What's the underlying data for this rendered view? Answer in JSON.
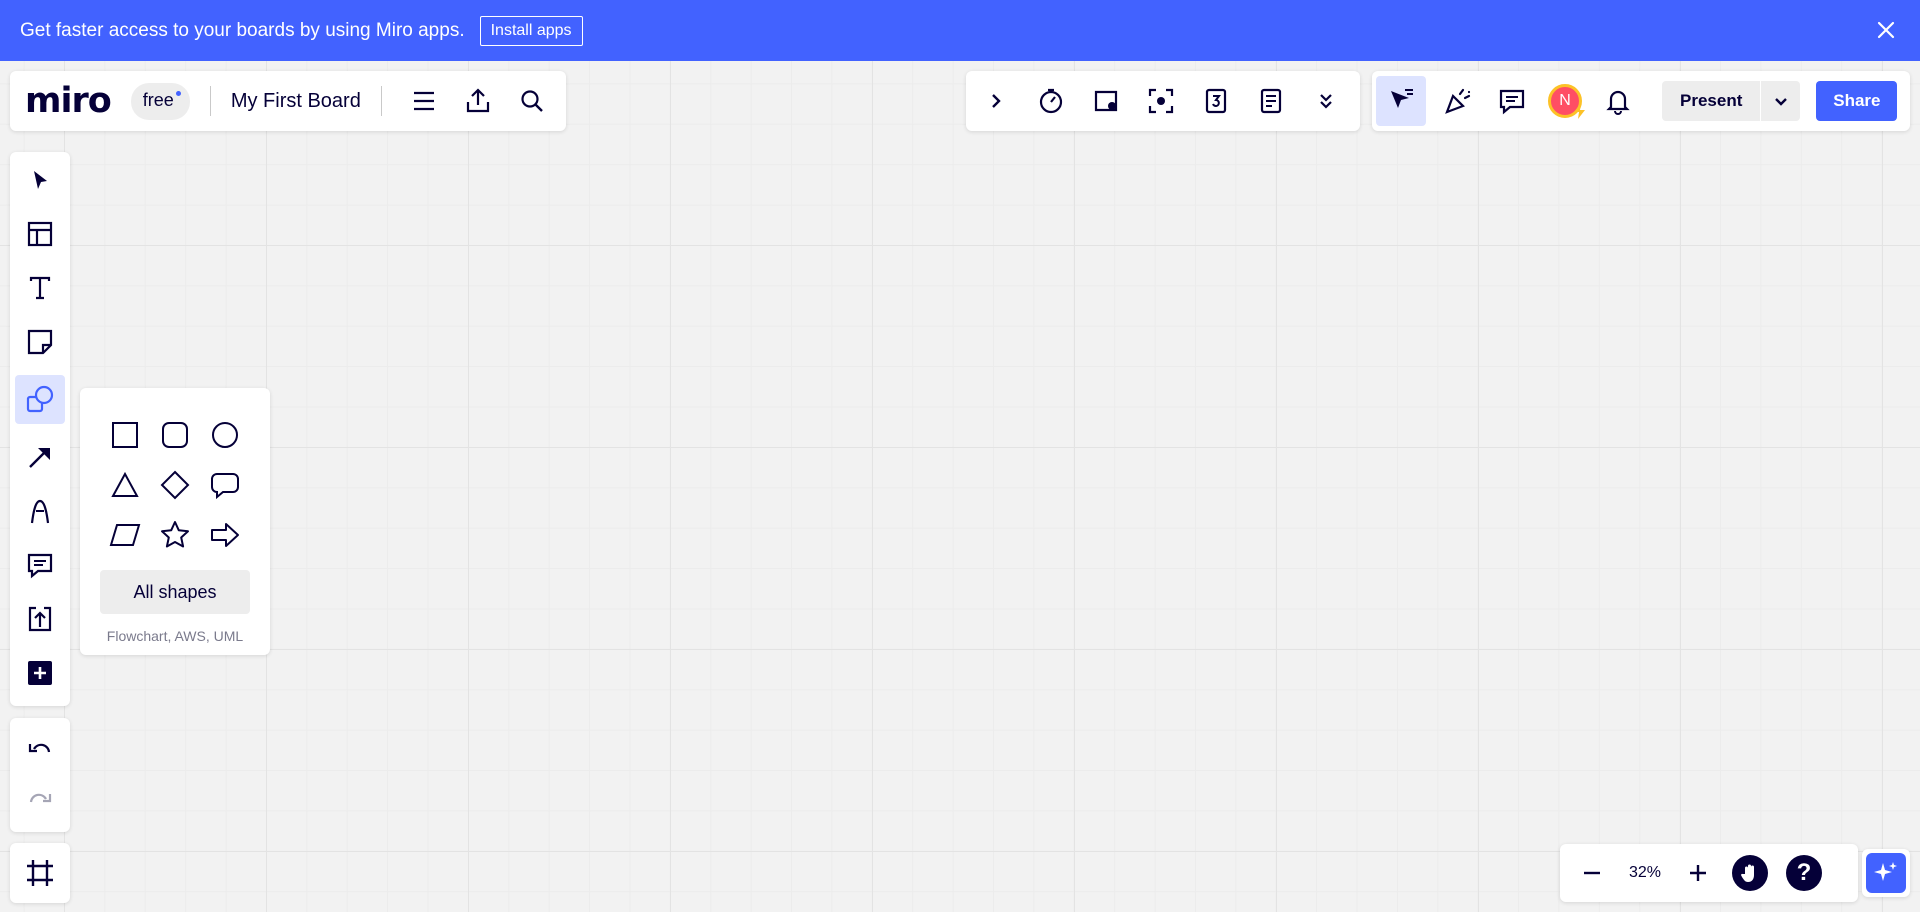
{
  "banner": {
    "message": "Get faster access to your boards by using Miro apps.",
    "install_label": "Install apps"
  },
  "board": {
    "logo": "miro",
    "plan": "free",
    "name": "My First Board"
  },
  "collab": {
    "avatar_initial": "N",
    "present_label": "Present",
    "share_label": "Share"
  },
  "shapes": {
    "all_shapes_label": "All shapes",
    "subtitle": "Flowchart, AWS, UML"
  },
  "zoom": {
    "level": "32%"
  },
  "help": {
    "label": "?"
  },
  "colors": {
    "accent": "#4262ff",
    "ink": "#050038",
    "avatar_bg": "#ff4e64",
    "avatar_ring": "#fcc227"
  },
  "icons": {
    "left_toolbar": [
      "cursor-icon",
      "templates-icon",
      "text-icon",
      "sticky-note-icon",
      "shapes-icon",
      "arrow-icon",
      "pen-icon",
      "comment-icon",
      "upload-icon",
      "more-apps-icon"
    ],
    "tools_toolbar": [
      "chevron-right-icon",
      "timer-icon",
      "voting-icon",
      "focus-icon",
      "countdown-icon",
      "notes-icon",
      "chevron-double-down-icon"
    ],
    "shape_options": [
      "square",
      "rounded-square",
      "circle",
      "triangle",
      "diamond",
      "speech-bubble",
      "parallelogram",
      "star",
      "arrow-right"
    ]
  }
}
